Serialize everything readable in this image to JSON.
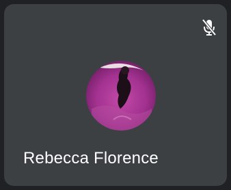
{
  "participant": {
    "name": "Rebecca Florence",
    "muted": true,
    "mute_icon": "microphone-off-icon",
    "avatar_icon": "profile-photo"
  },
  "colors": {
    "page_background": "#202124",
    "tile_background": "#3c4043",
    "name_text": "#ffffff",
    "avatar_accent": "#a2318f"
  }
}
